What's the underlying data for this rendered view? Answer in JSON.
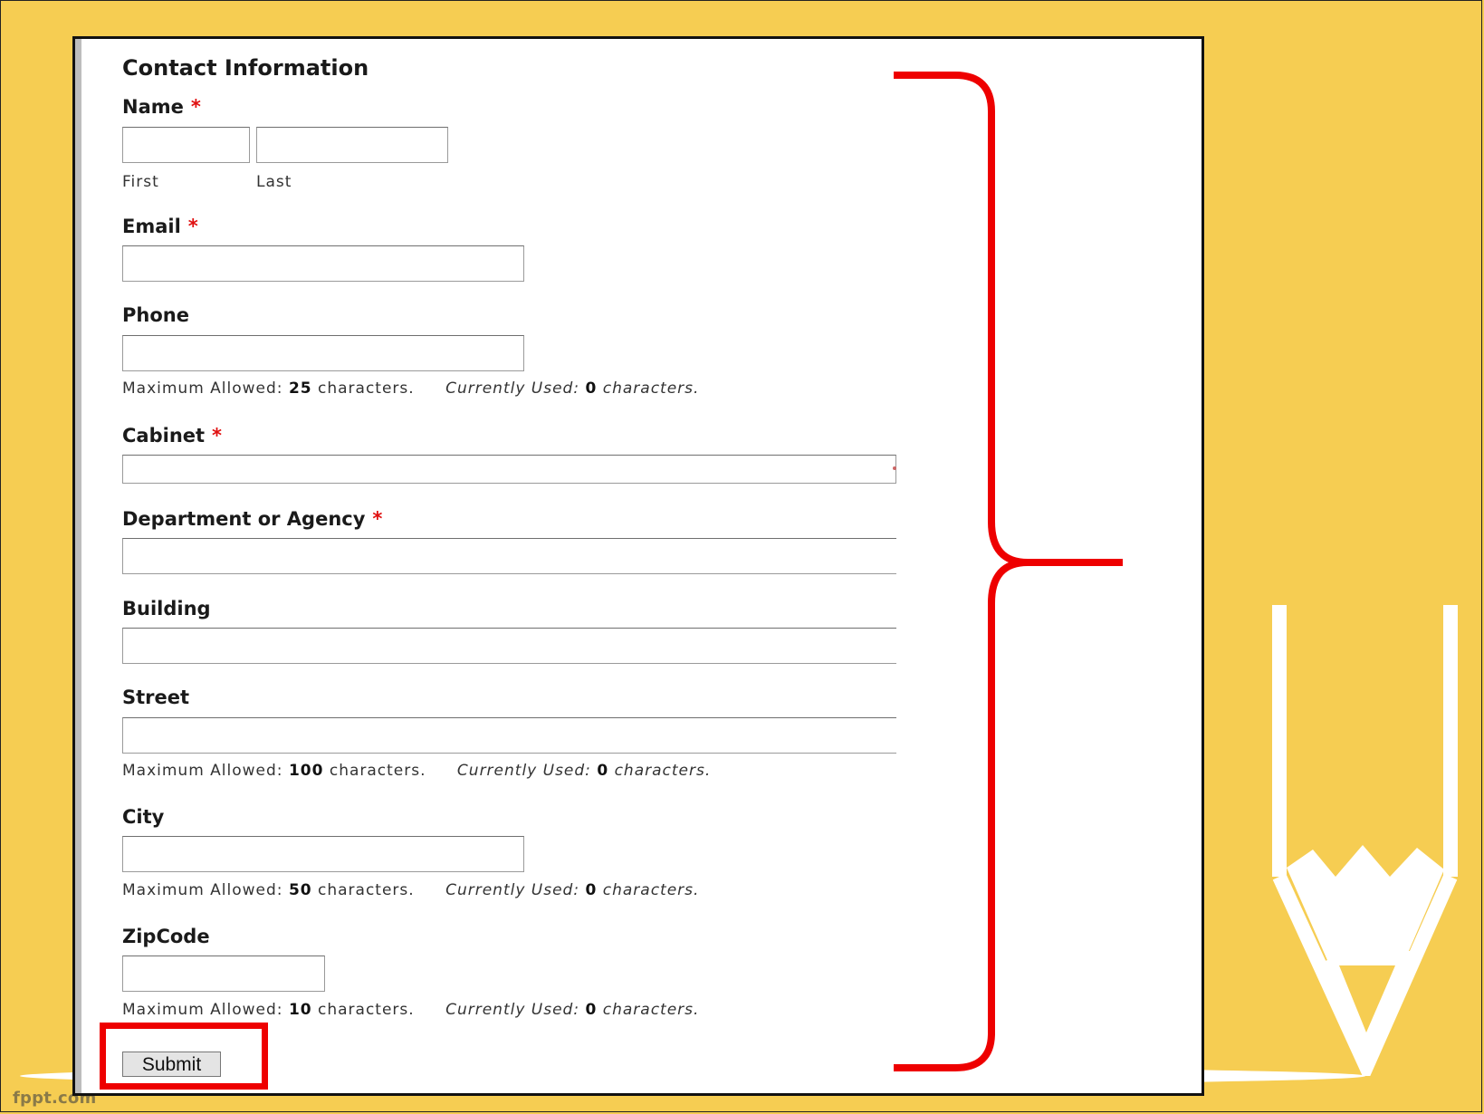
{
  "slide": {
    "footer_brand": "fppt.com",
    "colors": {
      "background": "#f6cd52",
      "highlight": "#ee0000",
      "required": "#e01010"
    }
  },
  "form": {
    "title": "Contact Information",
    "required_marker": "*",
    "name": {
      "label": "Name",
      "first_label": "First",
      "last_label": "Last",
      "first_value": "",
      "last_value": ""
    },
    "email": {
      "label": "Email",
      "value": ""
    },
    "phone": {
      "label": "Phone",
      "value": "",
      "hint": {
        "max_prefix": "Maximum Allowed:",
        "max_value": "25",
        "max_suffix": "characters.",
        "used_prefix": "Currently Used:",
        "used_value": "0",
        "used_suffix": "characters."
      }
    },
    "cabinet": {
      "label": "Cabinet",
      "value": ""
    },
    "department": {
      "label": "Department or Agency",
      "value": ""
    },
    "building": {
      "label": "Building",
      "value": ""
    },
    "street": {
      "label": "Street",
      "value": "",
      "hint": {
        "max_prefix": "Maximum Allowed:",
        "max_value": "100",
        "max_suffix": "characters.",
        "used_prefix": "Currently Used:",
        "used_value": "0",
        "used_suffix": "characters."
      }
    },
    "city": {
      "label": "City",
      "value": "",
      "hint": {
        "max_prefix": "Maximum Allowed:",
        "max_value": "50",
        "max_suffix": "characters.",
        "used_prefix": "Currently Used:",
        "used_value": "0",
        "used_suffix": "characters."
      }
    },
    "zipcode": {
      "label": "ZipCode",
      "value": "",
      "hint": {
        "max_prefix": "Maximum Allowed:",
        "max_value": "10",
        "max_suffix": "characters.",
        "used_prefix": "Currently Used:",
        "used_value": "0",
        "used_suffix": "characters."
      }
    },
    "submit_label": "Submit"
  }
}
